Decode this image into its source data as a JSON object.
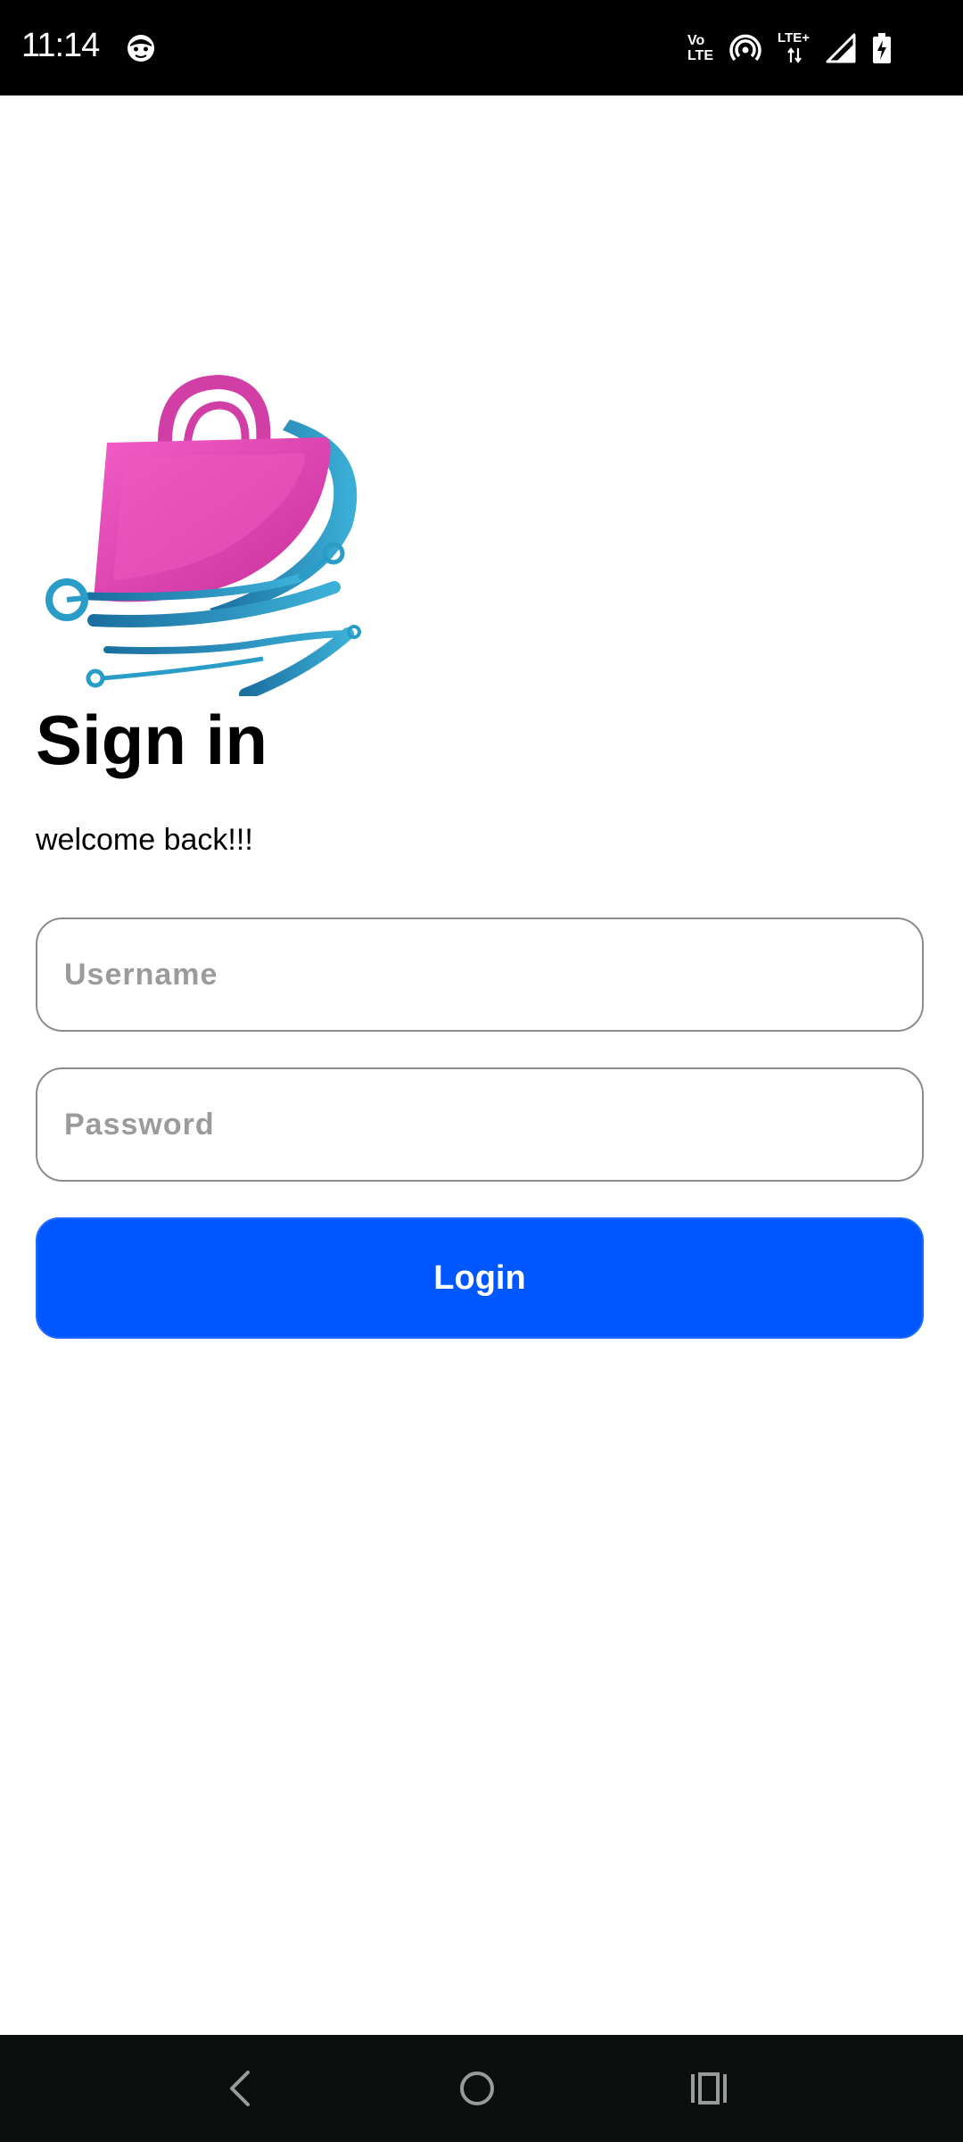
{
  "status_bar": {
    "time": "11:14",
    "volte_line1": "Vo",
    "volte_line2": "LTE",
    "lte_label": "LTE+"
  },
  "login": {
    "title": "Sign in",
    "subtitle": "welcome back!!!",
    "username_placeholder": "Username",
    "password_placeholder": "Password",
    "login_label": "Login"
  },
  "colors": {
    "primary_button": "#0057ff",
    "logo_pink": "#e040b0",
    "logo_blue": "#2a9cc8"
  },
  "icons": {
    "status_app": "face-icon",
    "hotspot": "hotspot-icon",
    "signal": "signal-icon",
    "battery": "battery-charging-icon",
    "nav_back": "back-icon",
    "nav_home": "home-icon",
    "nav_recents": "recents-icon"
  }
}
